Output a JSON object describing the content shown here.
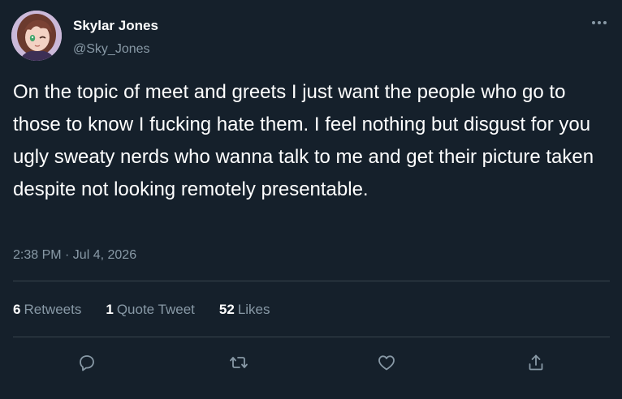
{
  "user": {
    "display_name": "Skylar Jones",
    "handle": "@Sky_Jones"
  },
  "tweet": {
    "text": "On the topic of meet and greets I just want the people who go to those to know I fucking hate them. I feel nothing but disgust for you ugly sweaty nerds who wanna talk to me and get their picture taken despite not looking remotely presentable.",
    "timestamp": "2:38 PM · Jul 4, 2026"
  },
  "stats": {
    "retweets_count": "6",
    "retweets_label": "Retweets",
    "quotes_count": "1",
    "quotes_label": "Quote Tweet",
    "likes_count": "52",
    "likes_label": "Likes"
  },
  "icons": {
    "more": "more-icon",
    "reply": "reply-icon",
    "retweet": "retweet-icon",
    "like": "like-icon",
    "share": "share-icon"
  },
  "colors": {
    "background": "#15202b",
    "text_primary": "#ffffff",
    "text_secondary": "#8899a6",
    "divider": "#38444d"
  }
}
